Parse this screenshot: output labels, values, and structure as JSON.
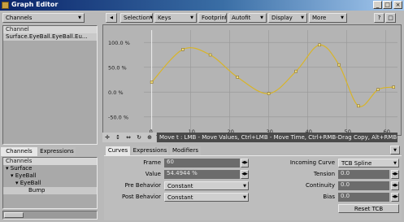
{
  "window": {
    "title": "Graph Editor",
    "close_glyph": "×",
    "max_glyph": "□",
    "min_glyph": "_"
  },
  "left": {
    "channels_dropdown": "Channels",
    "list_header": "Channel",
    "list_item": "Surface.EyeBall.EyeBall.Eu...",
    "tabs": [
      "Channels",
      "Expressions"
    ],
    "tree_header": "Channels",
    "tree": [
      "Surface",
      "EyeBall",
      "EyeBall",
      "Bump"
    ]
  },
  "toolbar": {
    "menus": [
      "Selection",
      "Keys",
      "Footprints",
      "Autofit",
      "Display",
      "More"
    ]
  },
  "graph": {
    "y_ticks": [
      "100.0 %",
      "50.0 %",
      "0.0 %",
      "-50.0 %"
    ],
    "x_ticks": [
      "0",
      "10",
      "20",
      "30",
      "40",
      "50",
      "60"
    ],
    "status": "Move t : LMB - Move Values, Ctrl+LMB - Move Time, Ctrl+RMB-Drag Copy, Alt+RMB-Select C..."
  },
  "chart_data": {
    "type": "line",
    "x": [
      0,
      8,
      15,
      22,
      30,
      37,
      43,
      48,
      53,
      58,
      62
    ],
    "y": [
      20,
      86,
      75,
      30,
      -3,
      42,
      95,
      55,
      -28,
      5,
      10
    ],
    "xlim": [
      -2,
      63
    ],
    "ylim": [
      -75,
      125
    ],
    "grid": true,
    "xlabel": "",
    "ylabel": ""
  },
  "bottom_tabs": [
    "Curves",
    "Expressions",
    "Modifiers"
  ],
  "curves": {
    "frame_label": "Frame",
    "frame_value": "60",
    "value_label": "Value",
    "value_value": "54.4944 %",
    "pre_label": "Pre Behavior",
    "pre_value": "Constant",
    "post_label": "Post Behavior",
    "post_value": "Constant",
    "incoming_label": "Incoming Curve",
    "incoming_value": "TCB Spline",
    "tension_label": "Tension",
    "tension_value": "0.0",
    "continuity_label": "Continuity",
    "continuity_value": "0.0",
    "bias_label": "Bias",
    "bias_value": "0.0",
    "reset_label": "Reset TCB"
  },
  "colors": {
    "curve": "#d8b428",
    "graph_bg": "#b4b4b4",
    "title": "#0a246a"
  }
}
